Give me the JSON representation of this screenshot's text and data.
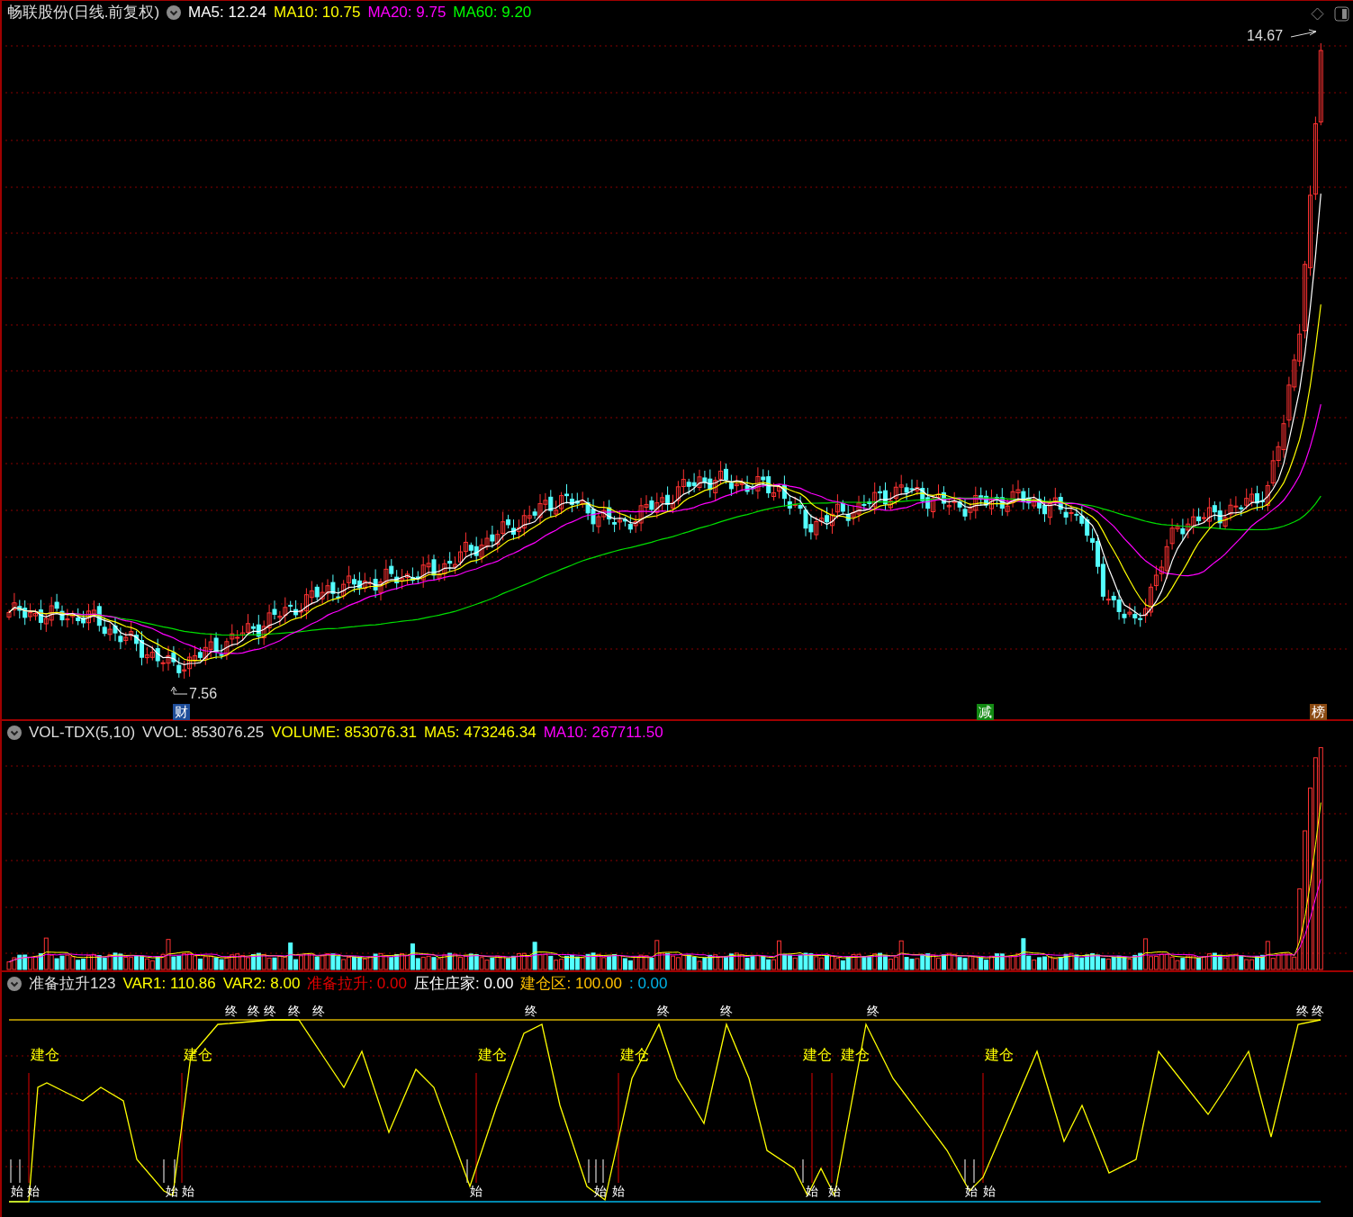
{
  "stock": {
    "title": "畅联股份(日线.前复权)",
    "readings": [
      {
        "text": "MA5: 12.24",
        "color": "#ffffff"
      },
      {
        "text": "MA10: 10.75",
        "color": "#ffff00"
      },
      {
        "text": "MA20: 9.75",
        "color": "#ff00ff"
      },
      {
        "text": "MA60: 9.20",
        "color": "#00ff00"
      }
    ]
  },
  "price_chart": {
    "high_label": "14.67",
    "low_label": "7.56",
    "events": [
      {
        "text": "财",
        "color": "#1e4d9a"
      },
      {
        "text": "减",
        "color": "#138a13"
      },
      {
        "text": "榜",
        "color": "#8b4a12"
      }
    ]
  },
  "volume": {
    "title": "VOL-TDX(5,10)",
    "readings": [
      {
        "text": "VVOL: 853076.25",
        "color": "#dddddd"
      },
      {
        "text": "VOLUME: 853076.31",
        "color": "#ffff00"
      },
      {
        "text": "MA5: 473246.34",
        "color": "#ffff00"
      },
      {
        "text": "MA10: 267711.50",
        "color": "#ff00ff"
      }
    ]
  },
  "indicator": {
    "title": "准备拉升123",
    "readings": [
      {
        "text": "VAR1: 110.86",
        "color": "#ffff00"
      },
      {
        "text": "VAR2: 8.00",
        "color": "#ffff00"
      },
      {
        "text": "准备拉升: 0.00",
        "color": "#e00000"
      },
      {
        "text": "压住庄家: 0.00",
        "color": "#ffffff"
      },
      {
        "text": "建仓区: 100.00",
        "color": "#ffc000"
      },
      {
        "text": ": 0.00",
        "color": "#00b4e8"
      }
    ],
    "build_labels": [
      "建仓",
      "建仓",
      "建仓",
      "建仓",
      "建仓",
      "建仓",
      "建仓"
    ],
    "end_marks": [
      "终",
      "终",
      "终",
      "终",
      "终",
      "终",
      "终",
      "终",
      "终",
      "终",
      "终"
    ],
    "start_marks": [
      "始",
      "始",
      "始",
      "始",
      "始",
      "始",
      "始",
      "始",
      "始",
      "始",
      "始"
    ]
  }
}
